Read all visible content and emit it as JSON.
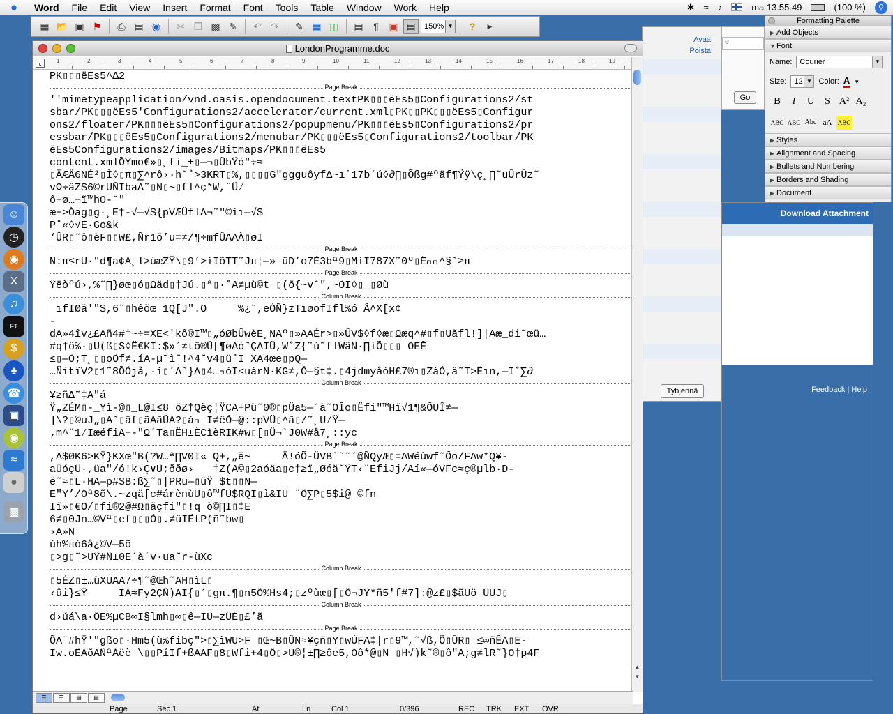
{
  "menubar": {
    "app_name": "Word",
    "items": [
      "File",
      "Edit",
      "View",
      "Insert",
      "Format",
      "Font",
      "Tools",
      "Table",
      "Window",
      "Work",
      "Help"
    ],
    "clock": "ma 13.55.49",
    "battery": "(100 %)"
  },
  "toolbar": {
    "zoom": "150%"
  },
  "browser": {
    "link_open": "Avaa",
    "link_delete": "Poista",
    "clear_button": "Tyhjennä",
    "go_button": "Go",
    "search_placeholder": "e"
  },
  "rpanel": {
    "download": "Download Attachment",
    "feedback": "Feedback",
    "separator": "|",
    "help": "Help"
  },
  "palette": {
    "title": "Formatting Palette",
    "sections": [
      "Add Objects",
      "Font",
      "Styles",
      "Alignment and Spacing",
      "Bullets and Numbering",
      "Borders and Shading",
      "Document"
    ],
    "name_label": "Name:",
    "font_name": "Courier",
    "size_label": "Size:",
    "font_size": "12",
    "color_label": "Color:",
    "format_buttons": [
      "B",
      "I",
      "U",
      "S",
      "A²",
      "A₂"
    ],
    "format_buttons2": [
      "ABC",
      "ABC",
      "Abc",
      "aA",
      "ABC"
    ]
  },
  "window": {
    "title": "LondonProgramme.doc",
    "ruler": [
      "1",
      "2",
      "3",
      "4",
      "5",
      "6",
      "7",
      "8",
      "9",
      "10",
      "11",
      "12",
      "13",
      "14",
      "15",
      "16",
      "17",
      "18",
      "19"
    ]
  },
  "document": {
    "blocks": [
      {
        "type": "text",
        "lines": [
          "PK▯▯▯ëEs5^Δ2"
        ]
      },
      {
        "type": "break",
        "label": "Page Break"
      },
      {
        "type": "text",
        "lines": [
          "''mimetypeapplication/vnd.oasis.opendocument.textPK▯▯▯ëEs5▯Configurations2/st",
          "sbar/PK▯▯▯ëEs5'Configurations2/accelerator/current.xml▯PK▯▯PK▯▯▯ëEs5▯Configur",
          "ons2/floater/PK▯▯▯ëEs5▯Configurations2/popupmenu/PK▯▯▯ëEs5▯Configurations2/pr",
          "essbar/PK▯▯▯ëEs5▯Configurations2/menubar/PK▯▯▯ëEs5▯Configurations2/toolbar/PK",
          "ëEs5Configurations2/images/Bitmaps/PK▯▯▯ëEs5",
          "content.xmlÕYmo€»▯¸fi_±▯—¬▯ÛbŸó\"÷≈",
          "▯ÄÆÄ6NÉ²▯Ì◊▯π▯∑^rô›·h˜˚>3KRT▯%,▯▯▯▯G\"ggguôyfΔ~ı˙17b´ú◊∂∏▯Õßg#ºäf¶Ÿÿ\\ç¸∏˜uÛrÛz˜",
          "vΩ÷âZ$6©rUÑIbaA˜▯N▯~▯fl^ç*W,¨Ü⁄",
          "ô+ø…¬ĩ™hO-˘\"",
          "æ+>Òag▯g·¸E†-√—√${pVÆÜflA¬˜\"©ìı—√$",
          "P˚«◊√E·Go&k",
          "‘ÛR▯˜ô▯èF▯▯W£,Ñr1õ’u=≠/¶÷mfÛAAÀ▯øI"
        ]
      },
      {
        "type": "break",
        "label": "Page Break"
      },
      {
        "type": "text",
        "lines": [
          "N:π≤rU·\"d¶a¢A¸l>ùæZŸ\\▯9’>íIõTT˜Jπ¦—» üD’o7É3bª9▯MíI787X˜0º▯È^§˜≥π"
        ]
      },
      {
        "type": "break",
        "label": "Page Break"
      },
      {
        "type": "text",
        "lines": [
          "Ÿëòºú›,%˜∏}øœ▯ó▯Ωäd▯†Jú.▯ª▯·˚A≠µù©t ▯(õ{~vˆ\",~ÕI◊▯_▯Øù"
        ]
      },
      {
        "type": "break",
        "label": "Column Break"
      },
      {
        "type": "text",
        "lines": [
          " ıfIØä'\"$,6˜▯hêõœ 1Q[J\".O     %¿˜,eÓÑ}zTıøofIfl%ó Â^X[x¢",
          "-",
          "dA»4îv¿£Añ4#†~÷=XE<'kô®I™▯„óØbÛwèE¸NAº▯»AAÉr>▯»ÛV$◊f◊æ▯Ωæq^#▯f▯Uãfl!]|Aæ_di˜œü…",
          "#q†ö%·▯U(ß▯S◊Ë€KI:$»´≠tö®Ú[¶øAò˜ÇAIÛ,W˚Z{˜ú˜flWâN·∏ìÕ▯▯▯ OEÊ",
          "≤▯—Õ;T¸▯▯oÕf≠.íA-µ˜ì˜!^4˜v4▯ü˚I XA4œe▯pQ—",
          "…ÑitïV2▯1˜8ÕÓjå,·ì▯´A˜}A▯4…óI<uárN·KG≠,Ó—§t‡.▯4jdmyåòH£7®ı▯ZàÓ,â˜T>Ëın,—I˚∑∂"
        ]
      },
      {
        "type": "break",
        "label": "Column Break"
      },
      {
        "type": "text",
        "lines": [
          "¥≥ñΔ˜‡A\"á",
          "Ÿ„ZÉM▯-_Yì-@▯_L@I≤8 öZ†Qèç¦ŸCA+Pù˜0®▯pÜa5—´ã˜OÎo▯Ëfi\"™Hï√1¶&ÕUÎ≠—",
          "]\\?▯©uJ„▯A˜▯âf▯ãAãÛA?▯á I≠êÓ—@::pVÜ▯^ã▯/˜¸U⁄Ÿ—",
          "‚m^¨1⁄IæéfiA+-\"Ω´Ta▯ËH±ÈCìèRIK#w▯[▯Ü¬`J0W#å7¸::yc"
        ]
      },
      {
        "type": "break",
        "label": "Page Break"
      },
      {
        "type": "text",
        "lines": [
          ",A$ØK6>KŸ}KXœ\"B(?W…ª∏V0I« Q+,„ë~     Ä!óÕ-ÜVB`˜˜´@ÑQyÆ▯=AWéûwf˜Õo/FAw*Q¥-",
          "aÜóçÛ·,üa\"/ó!k›Ç∨Û;ððø›   †Z(A©▯2aóäa▯c†≥ï„Øóä˜ŸT‹¨EfiJj/Aí«—óVFc≈ç®µlb·D-",
          "ë˜≈▯L·HA—p#SB:ß∑˜▯|PRu—▯üŸ $t▯▯N—",
          "E\"Y’/Óª8õ\\.~zqä[c#árènùU▯ô™fU$RQI▯ì&IÚ ¨Ö∑P▯5$i@ ©fn",
          "Iï»▯€O/▯fi®2@#Ω▯ãçfi\"▯!q ò©∏I▯‡E",
          "6≠▯0Jn…©Vª▯ef▯▯▯Ó▯.≠ûIËtP(ñ˜bw▯",
          "›A»N",
          "úh%πó6å¿©V—5õ",
          "▯>g▯˜>UŸ#Ñ±0E´à´v·ua˜r-ùXc"
        ]
      },
      {
        "type": "break",
        "label": "Column Break"
      },
      {
        "type": "text",
        "lines": [
          "▯5ÉZ▯±…ùXUAA7÷¶˜@Œh˜AH▯ìL▯",
          "‹ûi}≤Ÿ     IA≈Fy2ÇÑ)AI{▯´▯gπ.¶▯n5Õ%Hs4;▯zºùœ▯[▯Õ¬JŸ*ñ5'f#7]:@z£▯$ãUö ÛUJ▯"
        ]
      },
      {
        "type": "break",
        "label": "Column Break"
      },
      {
        "type": "text",
        "lines": [
          "d›úá\\a·ÕE%µCB∞I§lmh▯∞▯ê—IÜ—zÜÉ▯£’ã"
        ]
      },
      {
        "type": "break",
        "label": "Page Break"
      },
      {
        "type": "text",
        "lines": [
          "ÕA¨#hŸ'\"gßo▯·Hm5(ù%fibç\">▯∑ìWU>F ▯Œ~B▯ÛN≈¥çñ▯Y▯wÚFA‡|r▯9™,˜√ß,Õ▯ÛR▯ ≤∞ñÊA▯E-",
          "Iw.oËAõAÑªÁëè \\▯▯PíIf+ßAAF▯8▯Wfi+4▯Ö▯>U®¦±∏≥ôe5,Òô*@▯N ▯H√)k˜®▯ô\"A;g≠lR˜}Ó†p4F"
        ]
      }
    ]
  },
  "statusbar": {
    "page": "Page",
    "sec": "Sec  1",
    "at": "At",
    "ln": "Ln",
    "col": "Col  1",
    "count": "0/396",
    "rec": "REC",
    "trk": "TRK",
    "ext": "EXT",
    "ovr": "OVR"
  }
}
